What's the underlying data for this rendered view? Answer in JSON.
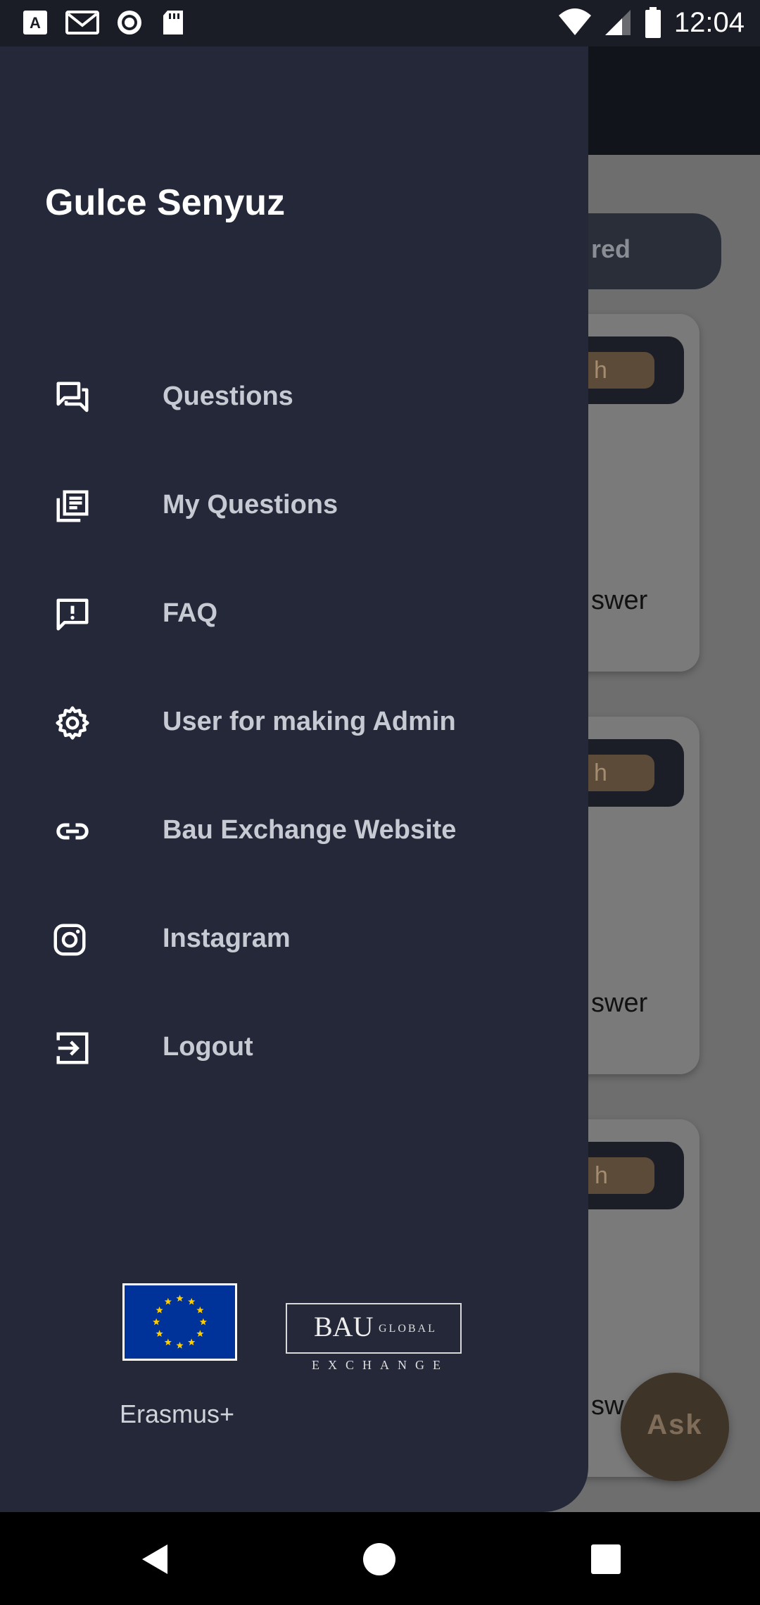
{
  "status_bar": {
    "time": "12:04",
    "left_icons": [
      "keyboard-a-icon",
      "gmail-icon",
      "record-icon",
      "sd-card-icon"
    ],
    "right_icons": [
      "wifi-icon",
      "cell-signal-icon",
      "battery-icon"
    ]
  },
  "drawer": {
    "user_name": "Gulce Senyuz",
    "menu": [
      {
        "label": "Questions",
        "icon": "forum-icon"
      },
      {
        "label": "My Questions",
        "icon": "library-books-icon"
      },
      {
        "label": "FAQ",
        "icon": "feedback-icon"
      },
      {
        "label": "User for making Admin",
        "icon": "gear-icon"
      },
      {
        "label": "Bau Exchange Website",
        "icon": "link-icon"
      },
      {
        "label": "Instagram",
        "icon": "instagram-icon"
      },
      {
        "label": "Logout",
        "icon": "logout-icon"
      }
    ],
    "logos": {
      "eu_caption": "Erasmus+",
      "bau_main": "BAU",
      "bau_global": "GLOBAL",
      "bau_exchange": "EXCHANGE"
    }
  },
  "background": {
    "filter_pill_partial": "red",
    "cards": [
      {
        "badge_partial": "h",
        "text_partial": "swer"
      },
      {
        "badge_partial": "h",
        "text_partial": "swer"
      },
      {
        "badge_partial": "l h",
        "text_partial": "sw"
      }
    ],
    "fab_label": "Ask"
  },
  "nav_bar": {
    "buttons": [
      "back-icon",
      "home-icon",
      "recents-icon"
    ]
  },
  "colors": {
    "drawer_bg": "#242838",
    "scrim_bg": "#6e6e6e",
    "menu_text": "#c7cad3",
    "badge_brown": "#5c4b38"
  }
}
